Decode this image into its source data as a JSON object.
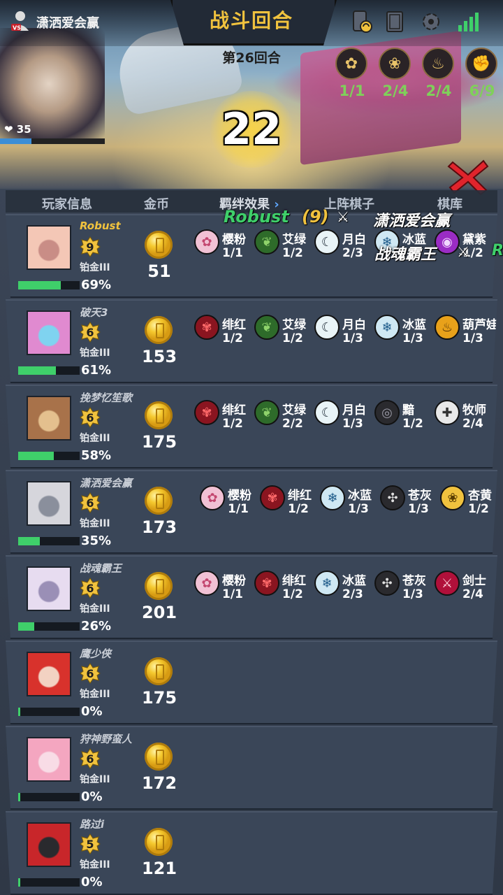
{
  "topbar": {
    "opponent_name": "潇洒爱会赢",
    "title": "战斗回合",
    "round_label": "第26回合",
    "hp": "35",
    "hp_fraction": 0.3,
    "timer": "22",
    "icons": [
      "phone-swap-icon",
      "card-deck-icon",
      "gear-icon",
      "signal-icon"
    ]
  },
  "top_synergies": [
    {
      "icon": "sakura-icon",
      "count": "1/1",
      "color": "#7fd05a"
    },
    {
      "icon": "lotus-icon",
      "count": "2/4",
      "color": "#7fd05a"
    },
    {
      "icon": "gourd-icon",
      "count": "2/4",
      "color": "#7fd05a"
    },
    {
      "icon": "fist-icon",
      "count": "6/9",
      "color": "#7fd05a"
    }
  ],
  "headers": {
    "player_info": "玩家信息",
    "gold": "金币",
    "bonds": "羁绊效果",
    "board": "上阵棋子",
    "bench": "棋库"
  },
  "match_tip": {
    "player": "Robust",
    "level": "(9)",
    "opponent1": "潇洒爱会赢",
    "opponent2": "战魂霸王",
    "cut_letter": "R"
  },
  "players": [
    {
      "name": "Robust",
      "highlight": true,
      "level": "9",
      "rank": "铂金III",
      "hp_pct": "69%",
      "hp_fraction": 0.69,
      "gold": "51",
      "avatar": [
        "#f4c7b6",
        "#c98d86"
      ],
      "synergies": [
        {
          "name": "樱粉",
          "count": "1/1",
          "icon": "sakura-icon",
          "bg": "#f1c1d4",
          "fg": "#c3466f",
          "glyph": "✿"
        },
        {
          "name": "艾绿",
          "count": "1/2",
          "icon": "leaf-icon",
          "bg": "#2e6b2a",
          "fg": "#8fd36b",
          "glyph": "❦"
        },
        {
          "name": "月白",
          "count": "2/3",
          "icon": "moon-icon",
          "bg": "#e9f4f7",
          "fg": "#1e2a36",
          "glyph": "☾"
        },
        {
          "name": "冰蓝",
          "count": "",
          "icon": "snowflake-icon",
          "bg": "#cfe8f3",
          "fg": "#1e5b8a",
          "glyph": "❄"
        },
        {
          "name": "黛紫",
          "count": "1/2",
          "icon": "purple-orb-icon",
          "bg": "#9a2cc4",
          "fg": "#f1d7ff",
          "glyph": "◉"
        }
      ]
    },
    {
      "name": "破天3",
      "highlight": false,
      "level": "6",
      "rank": "铂金III",
      "hp_pct": "61%",
      "hp_fraction": 0.61,
      "gold": "153",
      "avatar": [
        "#e08ad0",
        "#7fd3f0"
      ],
      "synergies": [
        {
          "name": "绯红",
          "count": "1/2",
          "icon": "rose-icon",
          "bg": "#8a1520",
          "fg": "#ff6a6a",
          "glyph": "✾"
        },
        {
          "name": "艾绿",
          "count": "1/2",
          "icon": "leaf-icon",
          "bg": "#2e6b2a",
          "fg": "#8fd36b",
          "glyph": "❦"
        },
        {
          "name": "月白",
          "count": "1/3",
          "icon": "moon-icon",
          "bg": "#e9f4f7",
          "fg": "#1e2a36",
          "glyph": "☾"
        },
        {
          "name": "冰蓝",
          "count": "1/3",
          "icon": "snowflake-icon",
          "bg": "#cfe8f3",
          "fg": "#1e5b8a",
          "glyph": "❄"
        },
        {
          "name": "葫芦娃",
          "count": "1/3",
          "icon": "gourd-icon",
          "bg": "#e8a11a",
          "fg": "#4a2a04",
          "glyph": "♨"
        }
      ]
    },
    {
      "name": "挽梦忆笙歌",
      "highlight": false,
      "level": "6",
      "rank": "铂金III",
      "hp_pct": "58%",
      "hp_fraction": 0.58,
      "gold": "175",
      "avatar": [
        "#a8724a",
        "#e4c08e"
      ],
      "synergies": [
        {
          "name": "绯红",
          "count": "1/2",
          "icon": "rose-icon",
          "bg": "#8a1520",
          "fg": "#ff6a6a",
          "glyph": "✾"
        },
        {
          "name": "艾绿",
          "count": "2/2",
          "icon": "leaf-icon",
          "bg": "#2e6b2a",
          "fg": "#8fd36b",
          "glyph": "❦"
        },
        {
          "name": "月白",
          "count": "1/3",
          "icon": "moon-icon",
          "bg": "#e9f4f7",
          "fg": "#1e2a36",
          "glyph": "☾"
        },
        {
          "name": "黯",
          "count": "1/2",
          "icon": "dark-eye-icon",
          "bg": "#2a2a2e",
          "fg": "#9a9aa6",
          "glyph": "◎"
        },
        {
          "name": "牧师",
          "count": "2/4",
          "icon": "priest-cross-icon",
          "bg": "#e8e8e8",
          "fg": "#333",
          "glyph": "✚"
        }
      ]
    },
    {
      "name": "潇洒爱会赢",
      "highlight": false,
      "level": "6",
      "rank": "铂金III",
      "hp_pct": "35%",
      "hp_fraction": 0.35,
      "gold": "173",
      "avatar": [
        "#d6d6dc",
        "#8a8f9c"
      ],
      "synergies": [
        {
          "name": "樱粉",
          "count": "1/1",
          "icon": "sakura-icon",
          "bg": "#f1c1d4",
          "fg": "#c3466f",
          "glyph": "✿"
        },
        {
          "name": "绯红",
          "count": "1/2",
          "icon": "rose-icon",
          "bg": "#8a1520",
          "fg": "#ff6a6a",
          "glyph": "✾"
        },
        {
          "name": "冰蓝",
          "count": "1/3",
          "icon": "snowflake-icon",
          "bg": "#cfe8f3",
          "fg": "#1e5b8a",
          "glyph": "❄"
        },
        {
          "name": "苍灰",
          "count": "1/3",
          "icon": "grey-swirl-icon",
          "bg": "#2a2a2e",
          "fg": "#e0e0e0",
          "glyph": "✣"
        },
        {
          "name": "杏黄",
          "count": "1/2",
          "icon": "lotus-icon",
          "bg": "#f0c23e",
          "fg": "#5a3d02",
          "glyph": "❀"
        }
      ]
    },
    {
      "name": "战魂霸王",
      "highlight": false,
      "level": "6",
      "rank": "铂金III",
      "hp_pct": "26%",
      "hp_fraction": 0.26,
      "gold": "201",
      "avatar": [
        "#e7dcf0",
        "#9a8fb6"
      ],
      "synergies": [
        {
          "name": "樱粉",
          "count": "1/1",
          "icon": "sakura-icon",
          "bg": "#f1c1d4",
          "fg": "#c3466f",
          "glyph": "✿"
        },
        {
          "name": "绯红",
          "count": "1/2",
          "icon": "rose-icon",
          "bg": "#8a1520",
          "fg": "#ff6a6a",
          "glyph": "✾"
        },
        {
          "name": "冰蓝",
          "count": "2/3",
          "icon": "snowflake-icon",
          "bg": "#cfe8f3",
          "fg": "#1e5b8a",
          "glyph": "❄"
        },
        {
          "name": "苍灰",
          "count": "1/3",
          "icon": "grey-swirl-icon",
          "bg": "#2a2a2e",
          "fg": "#e0e0e0",
          "glyph": "✣"
        },
        {
          "name": "剑士",
          "count": "2/4",
          "icon": "sword-icon",
          "bg": "#b0103a",
          "fg": "#ffd2dc",
          "glyph": "⚔"
        }
      ]
    },
    {
      "name": "鹰少侠",
      "highlight": false,
      "level": "6",
      "rank": "铂金III",
      "hp_pct": "0%",
      "hp_fraction": 0.0,
      "gold": "175",
      "avatar": [
        "#d8322c",
        "#f2d2c2"
      ],
      "synergies": []
    },
    {
      "name": "狩神野蛮人",
      "highlight": false,
      "level": "6",
      "rank": "铂金III",
      "hp_pct": "0%",
      "hp_fraction": 0.0,
      "gold": "172",
      "avatar": [
        "#f4a6c0",
        "#f8dce6"
      ],
      "synergies": []
    },
    {
      "name": "路过i",
      "highlight": false,
      "level": "5",
      "rank": "铂金III",
      "hp_pct": "0%",
      "hp_fraction": 0.0,
      "gold": "121",
      "avatar": [
        "#c8262a",
        "#2a2a2e"
      ],
      "synergies": []
    }
  ]
}
